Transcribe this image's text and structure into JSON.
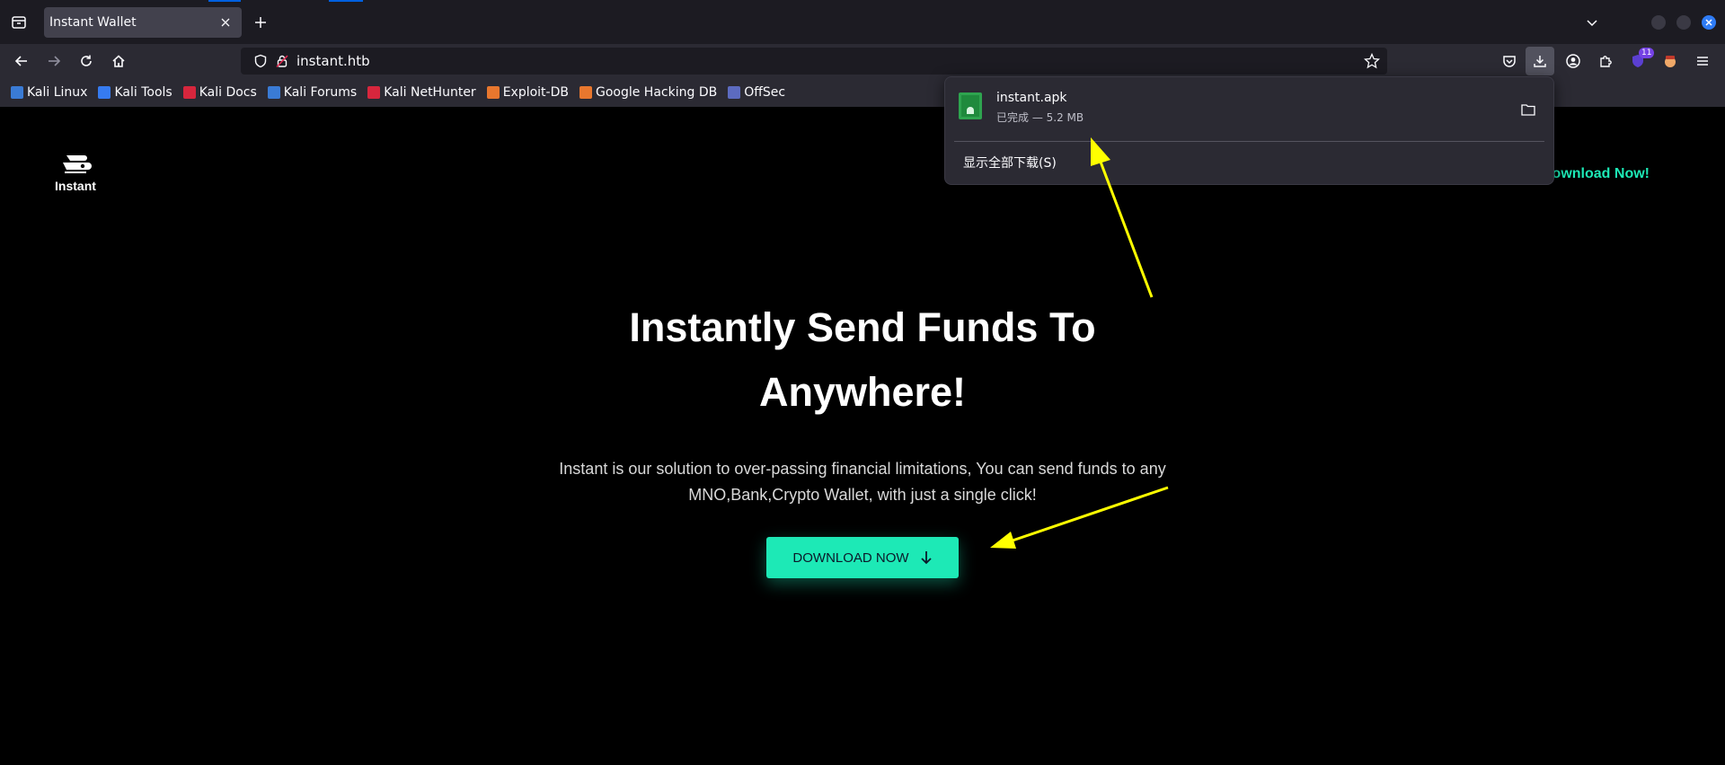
{
  "browser": {
    "tab": {
      "title": "Instant Wallet",
      "close_label": "×",
      "new_tab_label": "+"
    },
    "url": "instant.htb",
    "extensions_badge": "11",
    "bookmarks": [
      {
        "label": "Kali Linux",
        "color": "#3a7bd5"
      },
      {
        "label": "Kali Tools",
        "color": "#367bf0"
      },
      {
        "label": "Kali Docs",
        "color": "#d7263d"
      },
      {
        "label": "Kali Forums",
        "color": "#3a7bd5"
      },
      {
        "label": "Kali NetHunter",
        "color": "#d7263d"
      },
      {
        "label": "Exploit-DB",
        "color": "#e8772e"
      },
      {
        "label": "Google Hacking DB",
        "color": "#e8772e"
      },
      {
        "label": "OffSec",
        "color": "#5c6bc0"
      }
    ]
  },
  "downloads": {
    "file_name": "instant.apk",
    "status": "已完成 — 5.2 MB",
    "show_all": "显示全部下载(S)"
  },
  "page": {
    "logo_text": "Instant",
    "header_cta": "Download Now!",
    "hero_title_line1": "Instantly Send Funds To",
    "hero_title_line2": "Anywhere!",
    "hero_sub_line1": "Instant is our solution to over-passing financial limitations, You can send funds to any",
    "hero_sub_line2": "MNO,Bank,Crypto Wallet, with just a single click!",
    "cta_button": "DOWNLOAD NOW"
  },
  "colors": {
    "accent": "#1de9b6",
    "annotation_arrow": "#ffff00",
    "background": "#000000"
  }
}
